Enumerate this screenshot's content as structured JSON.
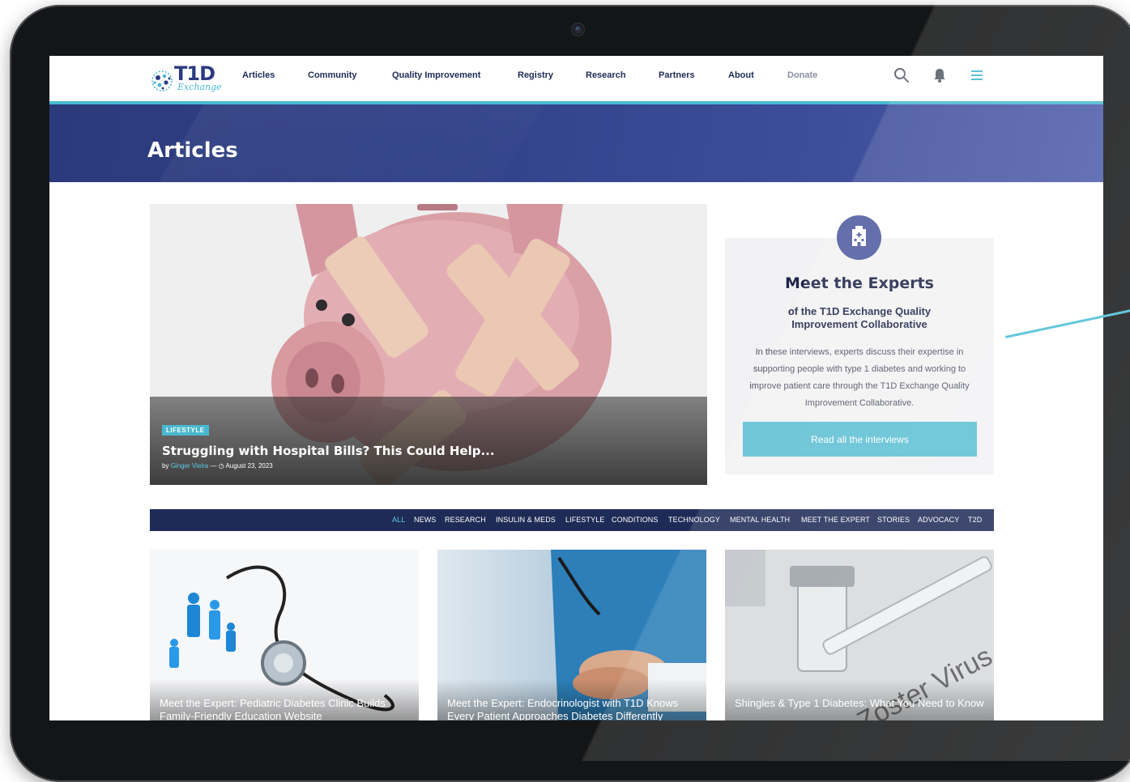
{
  "header": {
    "logo_text": "T1D",
    "logo_sub": "Exchange",
    "nav": [
      {
        "label": "Articles"
      },
      {
        "label": "Community"
      },
      {
        "label": "Quality Improvement"
      },
      {
        "label": "Registry"
      },
      {
        "label": "Research"
      },
      {
        "label": "Partners"
      },
      {
        "label": "About"
      },
      {
        "label": "Donate"
      }
    ],
    "icons": [
      "search-icon",
      "bell-icon",
      "menu-icon"
    ]
  },
  "banner": {
    "title": "Articles"
  },
  "featured": {
    "tag": "LIFESTYLE",
    "title": "Struggling with Hospital Bills? This Could Help...",
    "by": "by",
    "author": "Ginger Vieira",
    "sep": "—",
    "date": "August 23, 2023"
  },
  "experts": {
    "icon": "hospital-icon",
    "title": "Meet the Experts",
    "subtitle": "of the T1D Exchange Quality Improvement Collaborative",
    "description": "In these interviews, experts discuss their expertise in supporting people with type 1 diabetes and working to improve patient care through the T1D Exchange Quality Improvement Collaborative.",
    "button": "Read all the interviews"
  },
  "categories": [
    {
      "label": "ALL",
      "active": true
    },
    {
      "label": "NEWS"
    },
    {
      "label": "RESEARCH"
    },
    {
      "label": "INSULIN & MEDS"
    },
    {
      "label": "LIFESTYLE"
    },
    {
      "label": "CONDITIONS"
    },
    {
      "label": "TECHNOLOGY"
    },
    {
      "label": "MENTAL HEALTH"
    },
    {
      "label": "MEET THE EXPERT"
    },
    {
      "label": "STORIES"
    },
    {
      "label": "ADVOCACY"
    },
    {
      "label": "T2D"
    }
  ],
  "cards": [
    {
      "title": "Meet the Expert: Pediatric Diabetes Clinic Builds Family-Friendly Education Website"
    },
    {
      "title": "Meet the Expert: Endocrinologist with T1D Knows Every Patient Approaches Diabetes Differently"
    },
    {
      "title": "Shingles & Type 1 Diabetes: What You Need to Know"
    }
  ],
  "colors": {
    "navy": "#1f2b57",
    "accent": "#49b8cf",
    "banner": "#32428a",
    "button": "#5dbfd3"
  }
}
